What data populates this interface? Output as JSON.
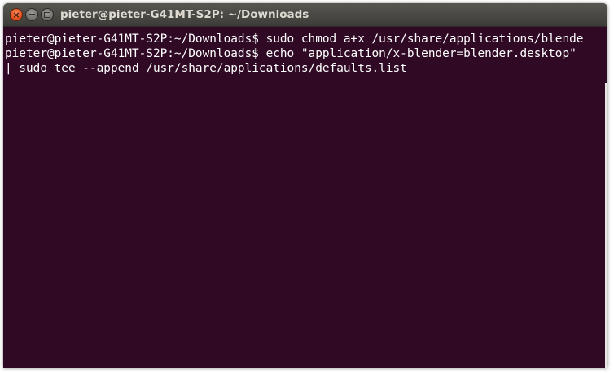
{
  "window": {
    "title": "pieter@pieter-G41MT-S2P: ~/Downloads",
    "close_glyph": "×"
  },
  "terminal": {
    "lines": [
      "pieter@pieter-G41MT-S2P:~/Downloads$ sudo chmod a+x /usr/share/applications/blende",
      "pieter@pieter-G41MT-S2P:~/Downloads$ echo \"application/x-blender=blender.desktop\"",
      "| sudo tee --append /usr/share/applications/defaults.list"
    ]
  },
  "colors": {
    "terminal_background": "#300a24",
    "terminal_foreground": "#ffffff",
    "titlebar": "#3d3c38",
    "close_button": "#df4a16"
  }
}
